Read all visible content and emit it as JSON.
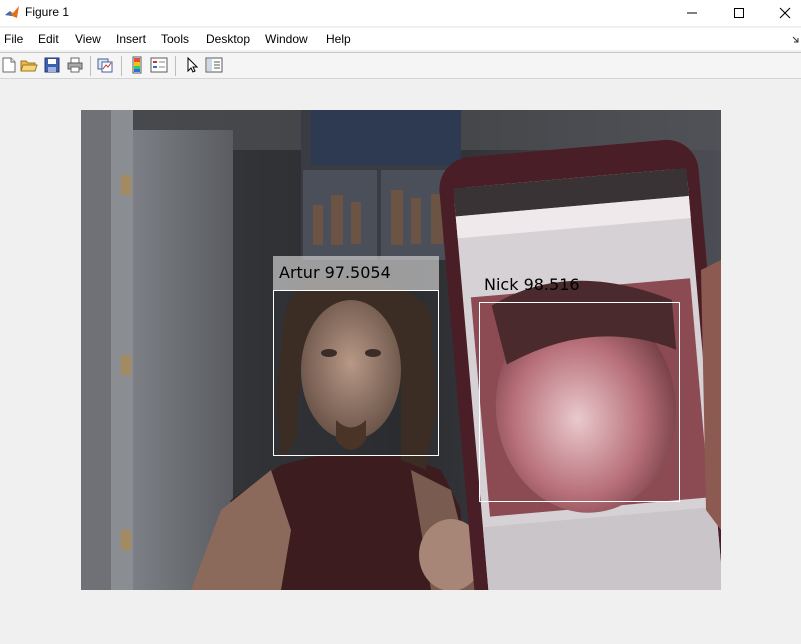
{
  "window": {
    "title": "Figure 1",
    "controls": {
      "minimize": "minimize",
      "maximize": "maximize",
      "close": "close"
    }
  },
  "menu": {
    "items": [
      "File",
      "Edit",
      "View",
      "Insert",
      "Tools",
      "Desktop",
      "Window",
      "Help"
    ]
  },
  "toolbar": {
    "buttons": [
      "new-figure-icon",
      "open-file-icon",
      "save-icon",
      "print-icon",
      "link-plot-icon",
      "insert-colorbar-icon",
      "insert-legend-icon",
      "pointer-icon",
      "property-editor-icon"
    ]
  },
  "figure": {
    "detections": [
      {
        "name": "Artur",
        "score": "97.5054",
        "label": "Artur 97.5054",
        "style": "boxed"
      },
      {
        "name": "Nick",
        "score": "98.516",
        "label": "Nick 98.516",
        "style": "plain"
      }
    ],
    "colors": {
      "box": "#ffffff",
      "label_bg": "#c8c8c8"
    }
  }
}
